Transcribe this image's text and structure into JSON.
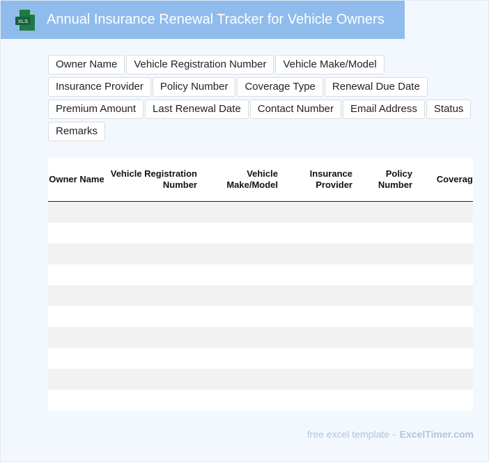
{
  "header": {
    "icon_label": "XLS",
    "title": "Annual Insurance Renewal Tracker for Vehicle Owners"
  },
  "fields": [
    "Owner Name",
    "Vehicle Registration Number",
    "Vehicle Make/Model",
    "Insurance Provider",
    "Policy Number",
    "Coverage Type",
    "Renewal Due Date",
    "Premium Amount",
    "Last Renewal Date",
    "Contact Number",
    "Email Address",
    "Status",
    "Remarks"
  ],
  "table": {
    "columns": [
      "Owner Name",
      "Vehicle Registration Number",
      "Vehicle Make/Model",
      "Insurance Provider",
      "Policy Number",
      "Coverage Type"
    ],
    "rows": [
      [
        "",
        "",
        "",
        "",
        "",
        ""
      ],
      [
        "",
        "",
        "",
        "",
        "",
        ""
      ],
      [
        "",
        "",
        "",
        "",
        "",
        ""
      ],
      [
        "",
        "",
        "",
        "",
        "",
        ""
      ],
      [
        "",
        "",
        "",
        "",
        "",
        ""
      ],
      [
        "",
        "",
        "",
        "",
        "",
        ""
      ],
      [
        "",
        "",
        "",
        "",
        "",
        ""
      ],
      [
        "",
        "",
        "",
        "",
        "",
        ""
      ],
      [
        "",
        "",
        "",
        "",
        "",
        ""
      ],
      [
        "",
        "",
        "",
        "",
        "",
        ""
      ]
    ]
  },
  "footer": {
    "text": "free excel template -",
    "brand": "ExcelTimer.com"
  },
  "colors": {
    "header_bg": "#8fbcec",
    "page_bg": "#f3f8fe",
    "icon_green": "#1f7a45",
    "row_stripe": "#f2f2f2"
  }
}
